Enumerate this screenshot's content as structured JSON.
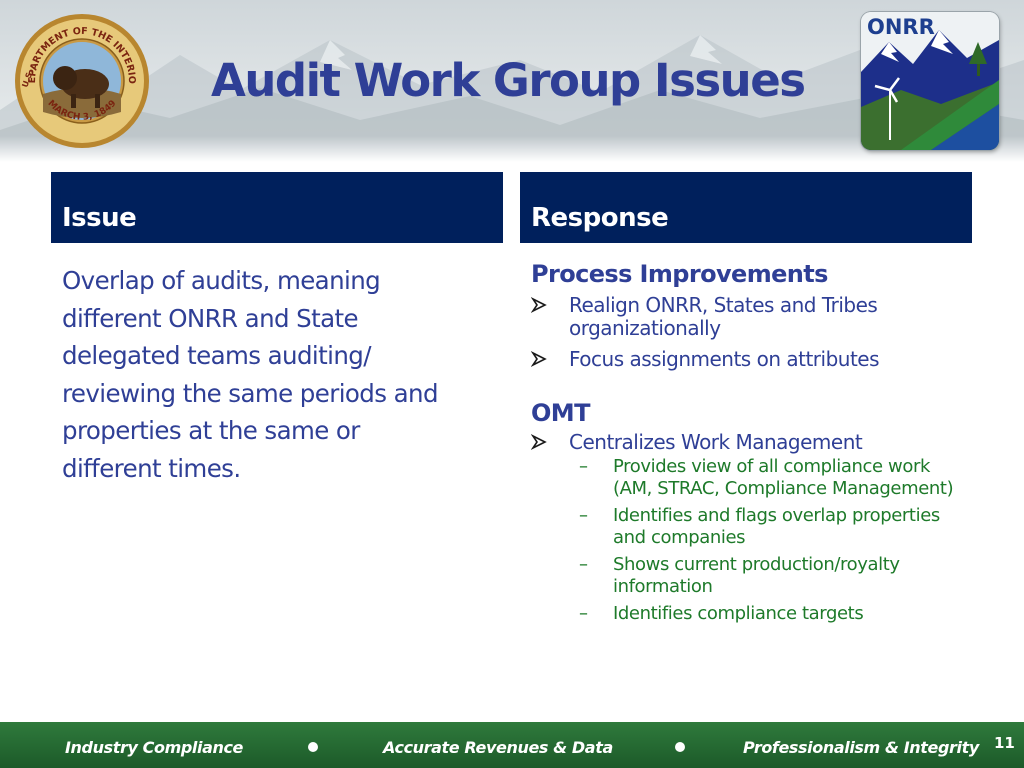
{
  "slide": {
    "title": "Audit Work Group Issues",
    "page_number": "11"
  },
  "seal": {
    "top_text": "DEPARTMENT OF THE INTERIOR",
    "left_text": "U.S.",
    "bottom_text": "MARCH 3, 1849"
  },
  "logo": {
    "label": "ONRR"
  },
  "issue": {
    "header": "Issue",
    "lines": [
      "Overlap of audits, meaning",
      "different ONRR and State",
      "delegated teams auditing/",
      "reviewing the same periods and",
      "properties at the same or",
      "different times."
    ]
  },
  "response": {
    "header": "Response",
    "process": {
      "title": "Process Improvements",
      "bullets": [
        "Realign ONRR, States and Tribes organizationally",
        "Focus assignments on attributes"
      ]
    },
    "omt": {
      "title": "OMT",
      "bullet": "Centralizes Work Management",
      "subs": [
        "Provides view of all compliance work (AM, STRAC, Compliance Management)",
        "Identifies and flags overlap properties and companies",
        "Shows current production/royalty information",
        "Identifies compliance targets"
      ]
    }
  },
  "footer": {
    "items": [
      "Industry Compliance",
      "Accurate Revenues & Data",
      "Professionalism & Integrity"
    ]
  },
  "colors": {
    "title": "#2f3f96",
    "header_bg": "#00205c",
    "sub_text": "#1e7a2a",
    "footer_bg": "#2f7a3c"
  }
}
